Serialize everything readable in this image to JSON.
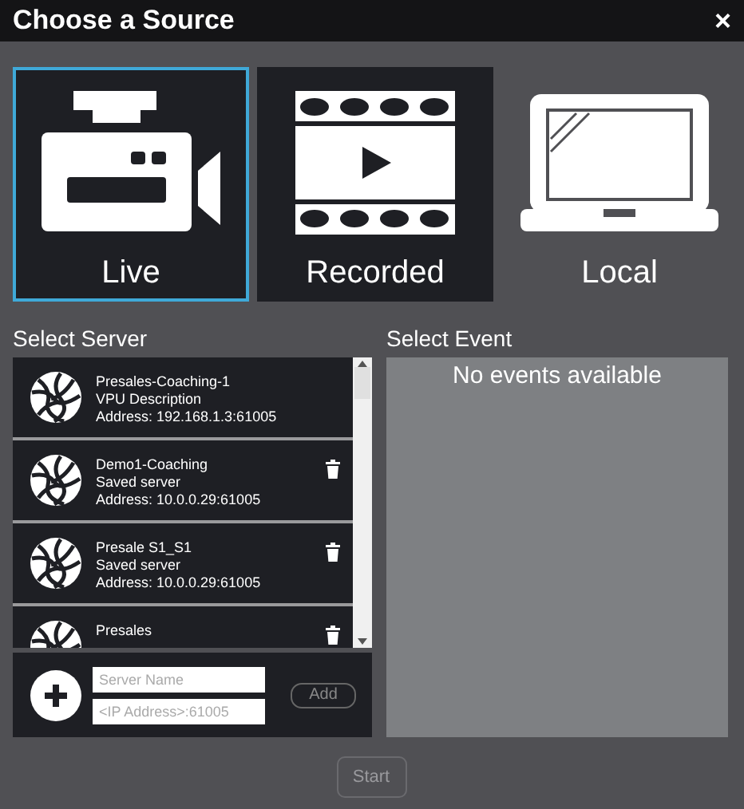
{
  "window": {
    "title": "Choose a Source",
    "close": "×"
  },
  "sources": [
    {
      "label": "Live",
      "kind": "camera",
      "selected": true
    },
    {
      "label": "Recorded",
      "kind": "film",
      "selected": false,
      "hovered": true
    },
    {
      "label": "Local",
      "kind": "laptop",
      "selected": false,
      "hovered": false
    }
  ],
  "server_section": {
    "title": "Select Server",
    "servers": [
      {
        "name": "Presales-Coaching-1",
        "description": "VPU Description",
        "address": "Address: 192.168.1.3:61005",
        "deletable": false
      },
      {
        "name": "Demo1-Coaching",
        "description": "Saved server",
        "address": "Address: 10.0.0.29:61005",
        "deletable": true
      },
      {
        "name": "Presale S1_S1",
        "description": "Saved server",
        "address": "Address: 10.0.0.29:61005",
        "deletable": true
      },
      {
        "name": "Presales",
        "deletable": true
      }
    ],
    "add_form": {
      "name_placeholder": "Server Name",
      "address_placeholder": "<IP Address>:61005",
      "button": "Add"
    }
  },
  "event_section": {
    "title": "Select Event",
    "empty_message": "No events available"
  },
  "start_button": {
    "label": "Start",
    "disabled": true
  }
}
